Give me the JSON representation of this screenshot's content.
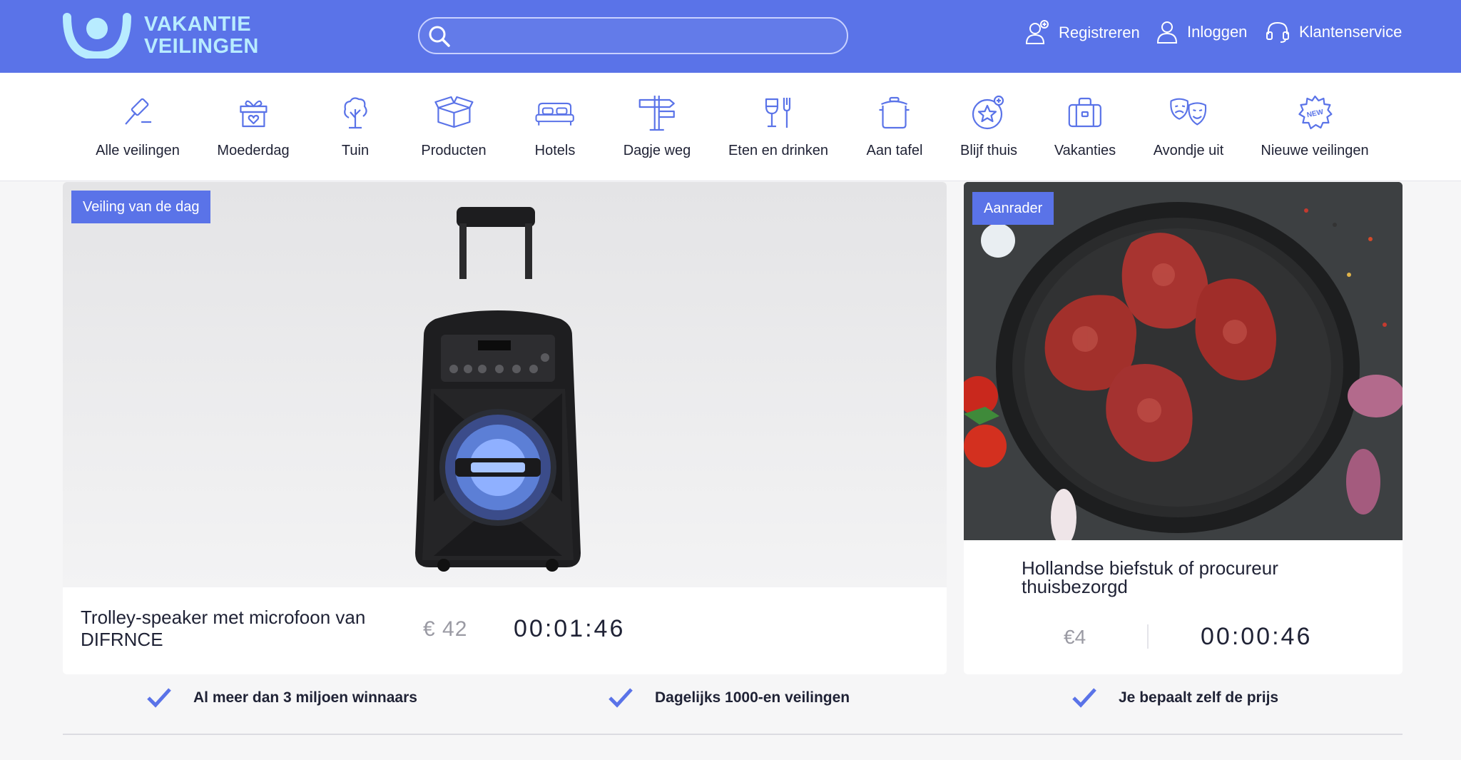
{
  "brand": {
    "line1": "VAKANTIE",
    "line2": "VEILINGEN"
  },
  "search": {
    "placeholder": "",
    "value": ""
  },
  "header_links": [
    {
      "label": "Registreren",
      "icon": "user-plus-icon"
    },
    {
      "label": "Inloggen",
      "icon": "user-icon"
    },
    {
      "label": "Klantenservice",
      "icon": "headset-icon"
    }
  ],
  "categories": [
    {
      "label": "Alle veilingen",
      "icon": "gavel-icon"
    },
    {
      "label": "Moederdag",
      "icon": "gift-icon"
    },
    {
      "label": "Tuin",
      "icon": "tree-icon"
    },
    {
      "label": "Producten",
      "icon": "box-icon"
    },
    {
      "label": "Hotels",
      "icon": "bed-icon"
    },
    {
      "label": "Dagje weg",
      "icon": "signpost-icon"
    },
    {
      "label": "Eten en drinken",
      "icon": "wine-fork-icon"
    },
    {
      "label": "Aan tafel",
      "icon": "pot-icon"
    },
    {
      "label": "Blijf thuis",
      "icon": "star-badge-icon"
    },
    {
      "label": "Vakanties",
      "icon": "suitcase-icon"
    },
    {
      "label": "Avondje uit",
      "icon": "theater-masks-icon"
    },
    {
      "label": "Nieuwe veilingen",
      "icon": "new-badge-icon"
    }
  ],
  "featured": {
    "tag": "Veiling van de dag",
    "title": "Trolley-speaker met microfoon van DIFRNCE",
    "price": "€ 42",
    "timer": "00:01:46"
  },
  "recommended": {
    "tag": "Aanrader",
    "title": "Hollandse biefstuk of procureur thuisbezorgd",
    "price": "€4",
    "timer": "00:00:46"
  },
  "usps": [
    "Al meer dan 3 miljoen winnaars",
    "Dagelijks 1000-en veilingen",
    "Je bepaalt zelf de prijs"
  ],
  "colors": {
    "brand_blue": "#5a73e8",
    "logo_cyan": "#b8ecff",
    "icon_blue": "#5a73e8",
    "muted_price": "#9a9aa3"
  }
}
